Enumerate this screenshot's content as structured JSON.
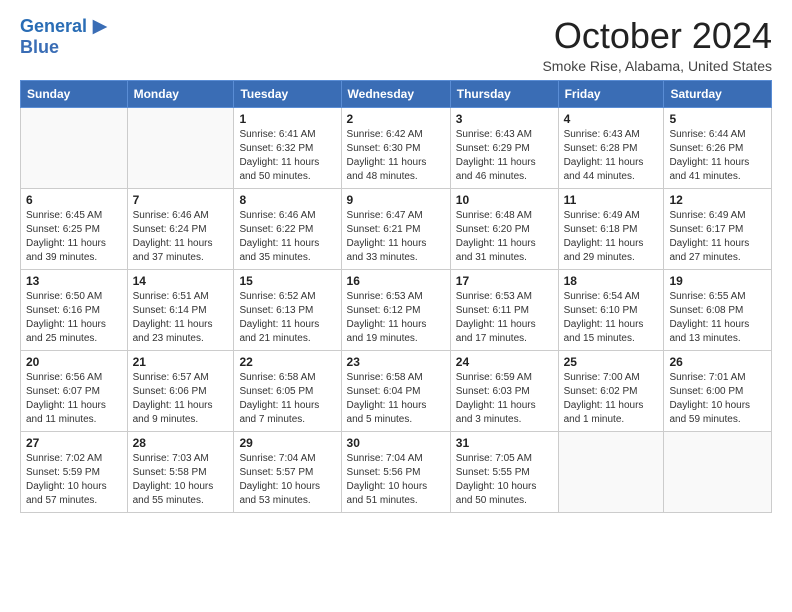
{
  "logo": {
    "line1": "General",
    "line2": "Blue",
    "icon": "▶"
  },
  "title": "October 2024",
  "location": "Smoke Rise, Alabama, United States",
  "weekdays": [
    "Sunday",
    "Monday",
    "Tuesday",
    "Wednesday",
    "Thursday",
    "Friday",
    "Saturday"
  ],
  "weeks": [
    [
      {
        "day": "",
        "info": ""
      },
      {
        "day": "",
        "info": ""
      },
      {
        "day": "1",
        "info": "Sunrise: 6:41 AM\nSunset: 6:32 PM\nDaylight: 11 hours and 50 minutes."
      },
      {
        "day": "2",
        "info": "Sunrise: 6:42 AM\nSunset: 6:30 PM\nDaylight: 11 hours and 48 minutes."
      },
      {
        "day": "3",
        "info": "Sunrise: 6:43 AM\nSunset: 6:29 PM\nDaylight: 11 hours and 46 minutes."
      },
      {
        "day": "4",
        "info": "Sunrise: 6:43 AM\nSunset: 6:28 PM\nDaylight: 11 hours and 44 minutes."
      },
      {
        "day": "5",
        "info": "Sunrise: 6:44 AM\nSunset: 6:26 PM\nDaylight: 11 hours and 41 minutes."
      }
    ],
    [
      {
        "day": "6",
        "info": "Sunrise: 6:45 AM\nSunset: 6:25 PM\nDaylight: 11 hours and 39 minutes."
      },
      {
        "day": "7",
        "info": "Sunrise: 6:46 AM\nSunset: 6:24 PM\nDaylight: 11 hours and 37 minutes."
      },
      {
        "day": "8",
        "info": "Sunrise: 6:46 AM\nSunset: 6:22 PM\nDaylight: 11 hours and 35 minutes."
      },
      {
        "day": "9",
        "info": "Sunrise: 6:47 AM\nSunset: 6:21 PM\nDaylight: 11 hours and 33 minutes."
      },
      {
        "day": "10",
        "info": "Sunrise: 6:48 AM\nSunset: 6:20 PM\nDaylight: 11 hours and 31 minutes."
      },
      {
        "day": "11",
        "info": "Sunrise: 6:49 AM\nSunset: 6:18 PM\nDaylight: 11 hours and 29 minutes."
      },
      {
        "day": "12",
        "info": "Sunrise: 6:49 AM\nSunset: 6:17 PM\nDaylight: 11 hours and 27 minutes."
      }
    ],
    [
      {
        "day": "13",
        "info": "Sunrise: 6:50 AM\nSunset: 6:16 PM\nDaylight: 11 hours and 25 minutes."
      },
      {
        "day": "14",
        "info": "Sunrise: 6:51 AM\nSunset: 6:14 PM\nDaylight: 11 hours and 23 minutes."
      },
      {
        "day": "15",
        "info": "Sunrise: 6:52 AM\nSunset: 6:13 PM\nDaylight: 11 hours and 21 minutes."
      },
      {
        "day": "16",
        "info": "Sunrise: 6:53 AM\nSunset: 6:12 PM\nDaylight: 11 hours and 19 minutes."
      },
      {
        "day": "17",
        "info": "Sunrise: 6:53 AM\nSunset: 6:11 PM\nDaylight: 11 hours and 17 minutes."
      },
      {
        "day": "18",
        "info": "Sunrise: 6:54 AM\nSunset: 6:10 PM\nDaylight: 11 hours and 15 minutes."
      },
      {
        "day": "19",
        "info": "Sunrise: 6:55 AM\nSunset: 6:08 PM\nDaylight: 11 hours and 13 minutes."
      }
    ],
    [
      {
        "day": "20",
        "info": "Sunrise: 6:56 AM\nSunset: 6:07 PM\nDaylight: 11 hours and 11 minutes."
      },
      {
        "day": "21",
        "info": "Sunrise: 6:57 AM\nSunset: 6:06 PM\nDaylight: 11 hours and 9 minutes."
      },
      {
        "day": "22",
        "info": "Sunrise: 6:58 AM\nSunset: 6:05 PM\nDaylight: 11 hours and 7 minutes."
      },
      {
        "day": "23",
        "info": "Sunrise: 6:58 AM\nSunset: 6:04 PM\nDaylight: 11 hours and 5 minutes."
      },
      {
        "day": "24",
        "info": "Sunrise: 6:59 AM\nSunset: 6:03 PM\nDaylight: 11 hours and 3 minutes."
      },
      {
        "day": "25",
        "info": "Sunrise: 7:00 AM\nSunset: 6:02 PM\nDaylight: 11 hours and 1 minute."
      },
      {
        "day": "26",
        "info": "Sunrise: 7:01 AM\nSunset: 6:00 PM\nDaylight: 10 hours and 59 minutes."
      }
    ],
    [
      {
        "day": "27",
        "info": "Sunrise: 7:02 AM\nSunset: 5:59 PM\nDaylight: 10 hours and 57 minutes."
      },
      {
        "day": "28",
        "info": "Sunrise: 7:03 AM\nSunset: 5:58 PM\nDaylight: 10 hours and 55 minutes."
      },
      {
        "day": "29",
        "info": "Sunrise: 7:04 AM\nSunset: 5:57 PM\nDaylight: 10 hours and 53 minutes."
      },
      {
        "day": "30",
        "info": "Sunrise: 7:04 AM\nSunset: 5:56 PM\nDaylight: 10 hours and 51 minutes."
      },
      {
        "day": "31",
        "info": "Sunrise: 7:05 AM\nSunset: 5:55 PM\nDaylight: 10 hours and 50 minutes."
      },
      {
        "day": "",
        "info": ""
      },
      {
        "day": "",
        "info": ""
      }
    ]
  ]
}
